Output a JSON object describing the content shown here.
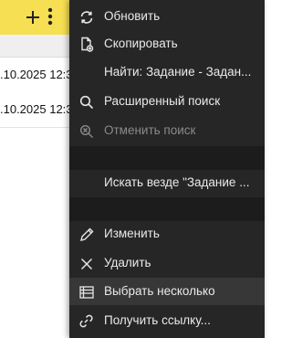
{
  "background": {
    "rows": [
      {
        "date": ".10.2025 12:3"
      },
      {
        "date": ".10.2025 12:3"
      }
    ],
    "toolbar_color": "#f6df52"
  },
  "menu": {
    "refresh": {
      "label": "Обновить",
      "icon": "refresh-icon"
    },
    "copy": {
      "label": "Скопировать",
      "icon": "copy-icon"
    },
    "find": {
      "label": "Найти: Задание - Задан..."
    },
    "advanced_search": {
      "label": "Расширенный поиск",
      "icon": "search-icon"
    },
    "cancel_search": {
      "label": "Отменить поиск",
      "icon": "cancel-search-icon",
      "disabled": true
    },
    "search_everywhere": {
      "label": "Искать везде \"Задание ..."
    },
    "edit": {
      "label": "Изменить",
      "icon": "pencil-icon"
    },
    "delete": {
      "label": "Удалить",
      "icon": "close-icon"
    },
    "select_multiple": {
      "label": "Выбрать несколько",
      "icon": "list-icon",
      "selected": true
    },
    "get_link": {
      "label": "Получить ссылку...",
      "icon": "link-icon"
    }
  }
}
